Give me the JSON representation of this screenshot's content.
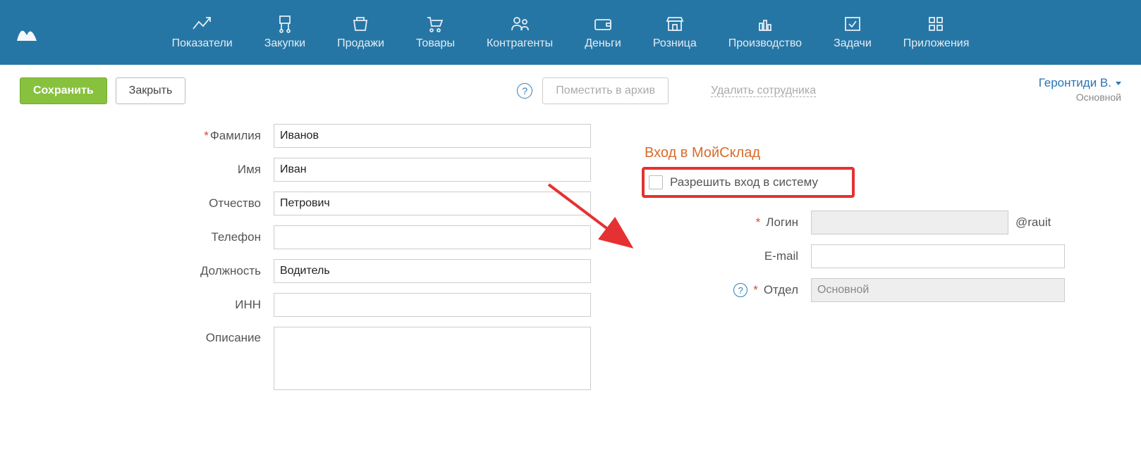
{
  "nav": {
    "items": [
      {
        "label": "Показатели"
      },
      {
        "label": "Закупки"
      },
      {
        "label": "Продажи"
      },
      {
        "label": "Товары"
      },
      {
        "label": "Контрагенты"
      },
      {
        "label": "Деньги"
      },
      {
        "label": "Розница"
      },
      {
        "label": "Производство"
      },
      {
        "label": "Задачи"
      },
      {
        "label": "Приложения"
      }
    ]
  },
  "actions": {
    "save": "Сохранить",
    "close": "Закрыть",
    "archive": "Поместить в архив",
    "delete": "Удалить сотрудника"
  },
  "user": {
    "name": "Геронтиди В.",
    "sub": "Основной"
  },
  "form_left": {
    "lastname_label": "Фамилия",
    "lastname_value": "Иванов",
    "firstname_label": "Имя",
    "firstname_value": "Иван",
    "patronymic_label": "Отчество",
    "patronymic_value": "Петрович",
    "phone_label": "Телефон",
    "phone_value": "",
    "position_label": "Должность",
    "position_value": "Водитель",
    "inn_label": "ИНН",
    "inn_value": "",
    "description_label": "Описание",
    "description_value": ""
  },
  "form_right": {
    "section_title": "Вход в МойСклад",
    "allow_login_label": "Разрешить вход в систему",
    "login_label": "Логин",
    "login_value": "",
    "login_suffix": "@rauit",
    "email_label": "E-mail",
    "email_value": "",
    "department_label": "Отдел",
    "department_value": "Основной"
  }
}
